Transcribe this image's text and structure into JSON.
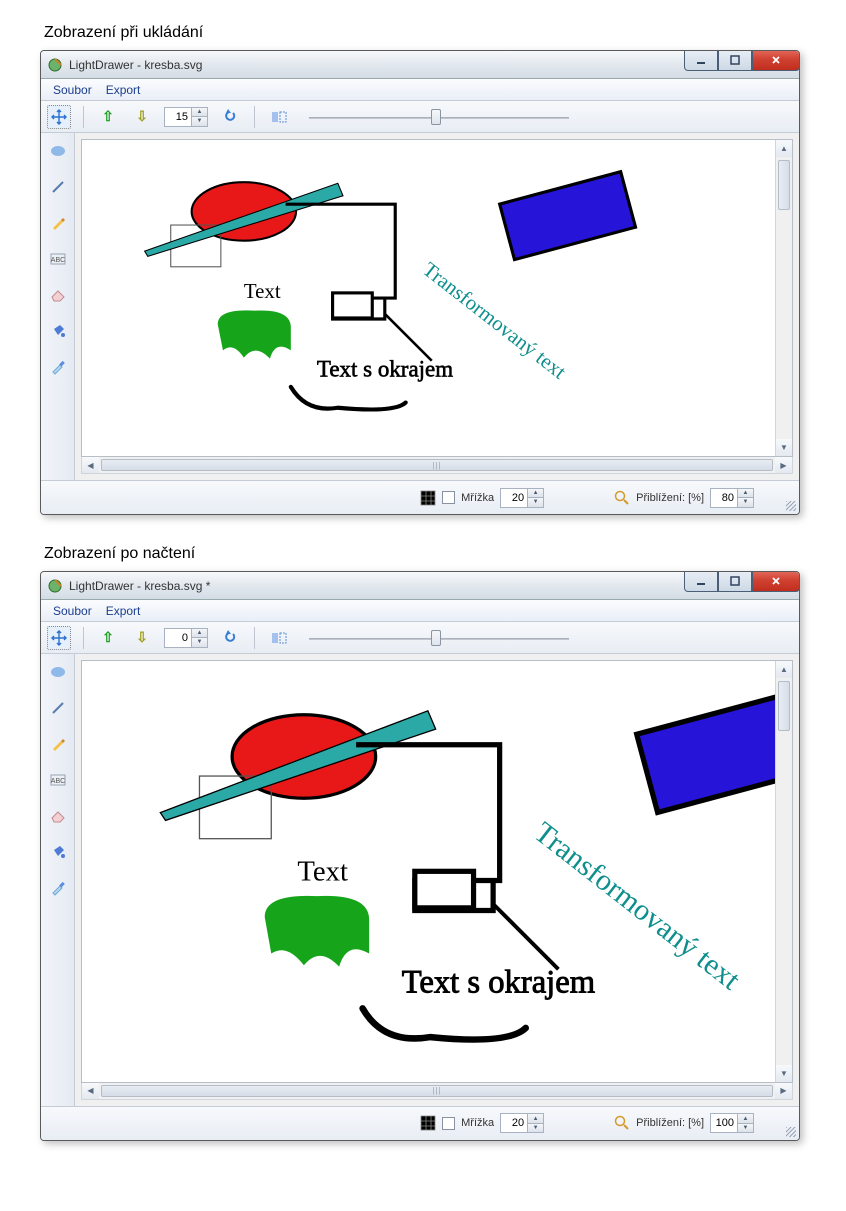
{
  "captions": {
    "top": "Zobrazení při ukládání",
    "bottom": "Zobrazení po načtení"
  },
  "win1": {
    "title": "LightDrawer - kresba.svg",
    "menu": {
      "file": "Soubor",
      "export": "Export"
    },
    "toolbar": {
      "spinner": "15"
    },
    "status": {
      "gridLabel": "Mřížka",
      "gridValue": "20",
      "zoomLabel": "Přiblížení: [%]",
      "zoomValue": "80"
    },
    "canvas": {
      "text1": "Text",
      "text2": "Text s okrajem",
      "text3": "Transformovaný text"
    }
  },
  "win2": {
    "title": "LightDrawer - kresba.svg *",
    "menu": {
      "file": "Soubor",
      "export": "Export"
    },
    "toolbar": {
      "spinner": "0"
    },
    "status": {
      "gridLabel": "Mřížka",
      "gridValue": "20",
      "zoomLabel": "Přiblížení: [%]",
      "zoomValue": "100"
    },
    "canvas": {
      "text1": "Text",
      "text2": "Text s okrajem",
      "text3": "Transformovaný text"
    }
  },
  "icons": {
    "move": "move-icon",
    "shape": "blob-icon",
    "line": "line-icon",
    "pencil": "pencil-icon",
    "text": "text-tool-icon",
    "eraser": "eraser-icon",
    "bucket": "bucket-icon",
    "dropper": "dropper-icon",
    "arrowUp": "arrow-up-icon",
    "arrowDown": "arrow-down-icon",
    "undo": "undo-icon",
    "flip": "flip-icon",
    "gridStatus": "grid-icon",
    "magnifier": "magnifier-icon"
  }
}
